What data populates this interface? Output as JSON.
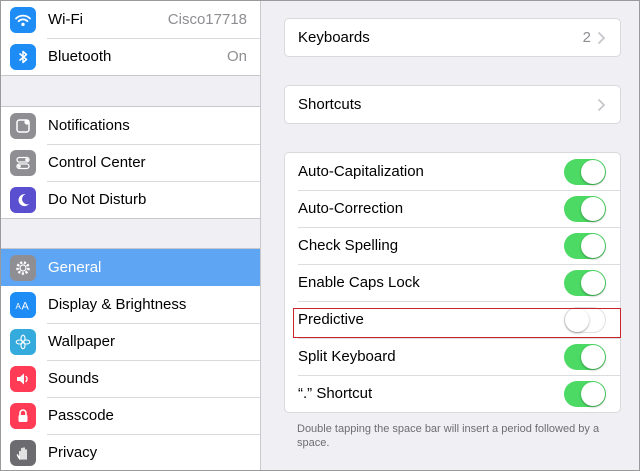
{
  "sidebar": {
    "group1": [
      {
        "label": "Wi-Fi",
        "value": "Cisco17718",
        "icon": "wifi-icon",
        "color": "#1e8cf5"
      },
      {
        "label": "Bluetooth",
        "value": "On",
        "icon": "bluetooth-icon",
        "color": "#1e8cf5"
      }
    ],
    "group2": [
      {
        "label": "Notifications",
        "icon": "notifications-icon",
        "color": "#8e8e93"
      },
      {
        "label": "Control Center",
        "icon": "control-center-icon",
        "color": "#8e8e93"
      },
      {
        "label": "Do Not Disturb",
        "icon": "moon-icon",
        "color": "#5a4fcf"
      }
    ],
    "group3": [
      {
        "label": "General",
        "icon": "gear-icon",
        "color": "#8e8e93",
        "selected": true
      },
      {
        "label": "Display & Brightness",
        "icon": "display-brightness-icon",
        "color": "#1e8cf5"
      },
      {
        "label": "Wallpaper",
        "icon": "wallpaper-icon",
        "color": "#35aadc"
      },
      {
        "label": "Sounds",
        "icon": "sounds-icon",
        "color": "#ff3b55"
      },
      {
        "label": "Passcode",
        "icon": "passcode-lock-icon",
        "color": "#ff3b55"
      },
      {
        "label": "Privacy",
        "icon": "privacy-hand-icon",
        "color": "#6b6b70"
      }
    ]
  },
  "detail": {
    "keyboards": {
      "label": "Keyboards",
      "value": "2"
    },
    "shortcuts": {
      "label": "Shortcuts"
    },
    "toggles": [
      {
        "label": "Auto-Capitalization",
        "on": true
      },
      {
        "label": "Auto-Correction",
        "on": true
      },
      {
        "label": "Check Spelling",
        "on": true
      },
      {
        "label": "Enable Caps Lock",
        "on": true
      },
      {
        "label": "Predictive",
        "on": false
      },
      {
        "label": "Split Keyboard",
        "on": true
      },
      {
        "label": "“.” Shortcut",
        "on": true
      }
    ],
    "footnote": "Double tapping the space bar will insert a period followed by a space."
  },
  "colors": {
    "toggle_on": "#4cd964",
    "selected_row": "#5ea5f4",
    "highlight_box": "#c9252b"
  }
}
